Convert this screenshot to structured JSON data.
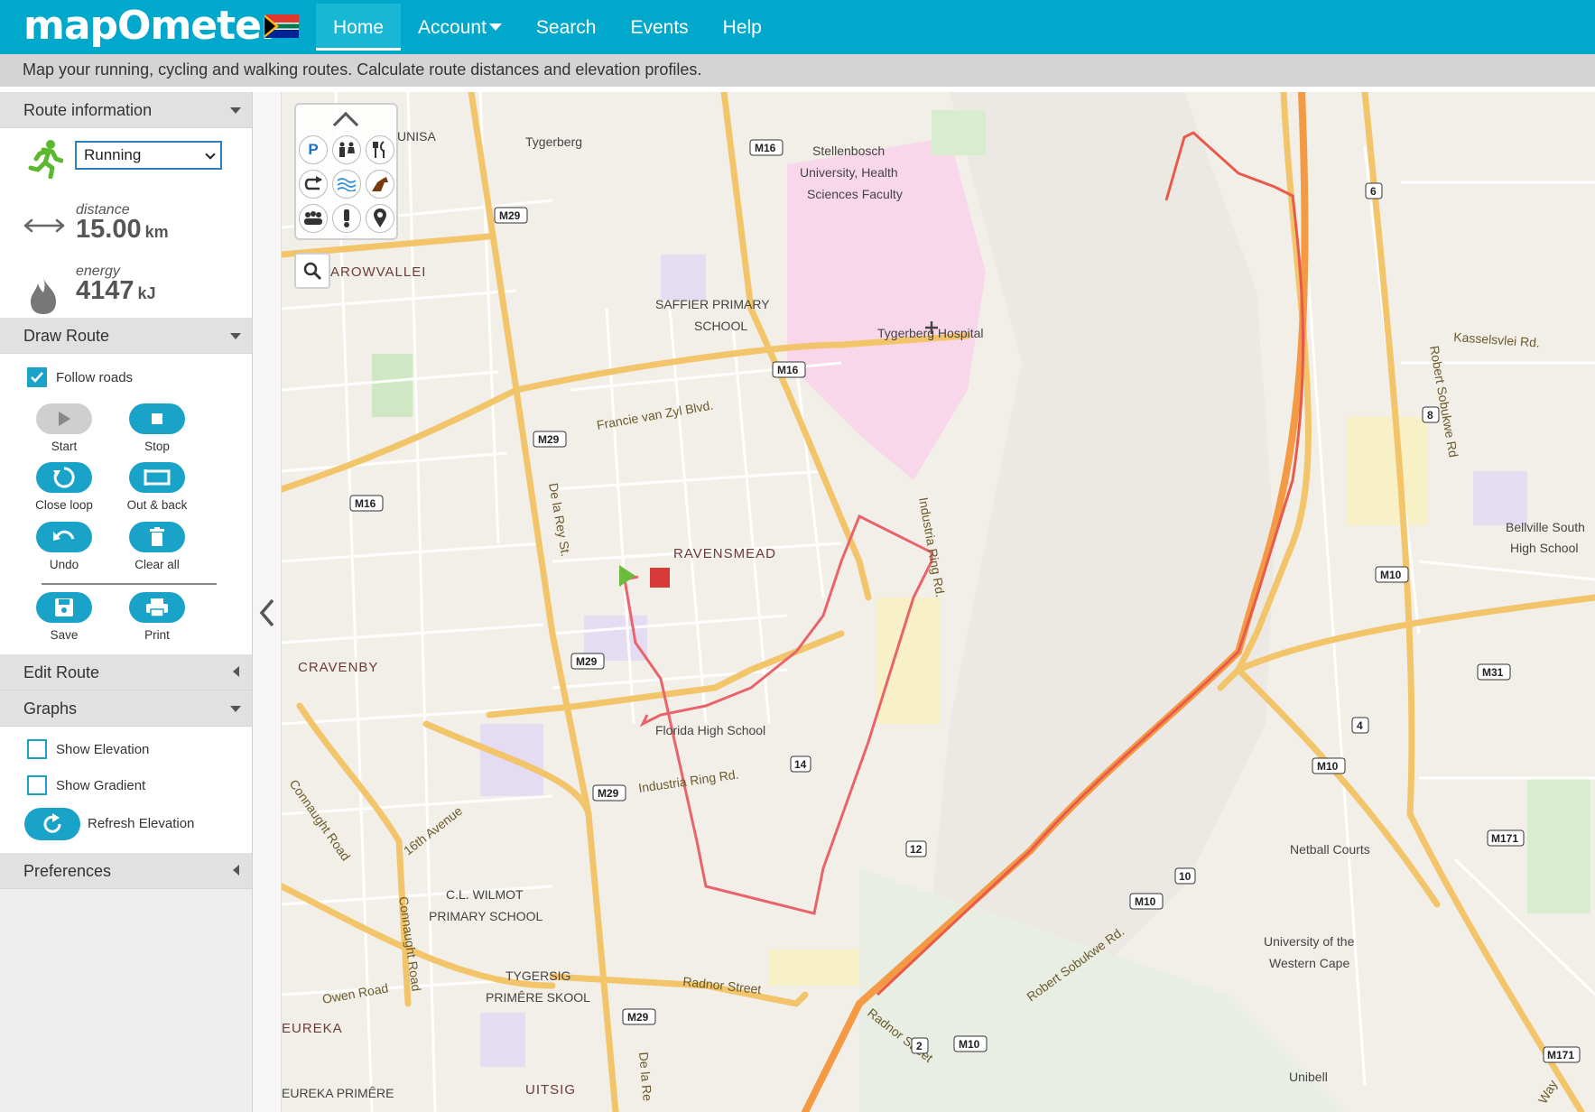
{
  "app": {
    "logo": "mapOmeter",
    "tagline": "Map your running, cycling and walking routes. Calculate route distances and elevation profiles."
  },
  "nav": {
    "items": [
      "Home",
      "Account",
      "Search",
      "Events",
      "Help"
    ],
    "active": "Home"
  },
  "route_info": {
    "header": "Route information",
    "activity": "Running",
    "distance_label": "distance",
    "distance_value": "15.00",
    "distance_unit": "km",
    "energy_label": "energy",
    "energy_value": "4147",
    "energy_unit": "kJ"
  },
  "draw_route": {
    "header": "Draw Route",
    "follow_roads": "Follow roads",
    "follow_roads_checked": true,
    "buttons": {
      "start": "Start",
      "stop": "Stop",
      "close_loop": "Close loop",
      "out_back": "Out & back",
      "undo": "Undo",
      "clear_all": "Clear all",
      "save": "Save",
      "print": "Print"
    }
  },
  "edit_route": {
    "header": "Edit Route"
  },
  "graphs": {
    "header": "Graphs",
    "show_elevation": "Show Elevation",
    "show_gradient": "Show Gradient",
    "refresh_elevation": "Refresh Elevation"
  },
  "preferences": {
    "header": "Preferences"
  },
  "colors": {
    "brand": "#00a9cc",
    "button": "#1aa3c8",
    "route": "#e8646a",
    "start_marker": "#6cbb3c",
    "end_marker": "#d83a3a"
  },
  "map": {
    "labels": {
      "unisa": "UNISA",
      "tygerberg": "Tygerberg",
      "stellenbosch1": "Stellenbosch",
      "stellenbosch2": "University, Health",
      "stellenbosch3": "Sciences Faculty",
      "tygerberg_hospital": "Tygerberg Hospital",
      "saffier1": "SAFFIER PRIMARY",
      "saffier2": "SCHOOL",
      "arowvallei": "AROWVALLEI",
      "ravensmead": "RAVENSMEAD",
      "cravenby": "CRAVENBY",
      "florida": "Florida High School",
      "wilmot1": "C.L. WILMOT",
      "wilmot2": "PRIMARY SCHOOL",
      "tygersig1": "TYGERSIG",
      "tygersig2": "PRIMÊRE SKOOL",
      "eureka": "EUREKA",
      "eureka_primere": "EUREKA PRIMÊRE",
      "uitsig": "UITSIG",
      "bellville1": "Bellville South",
      "bellville2": "High School",
      "netball": "Netball Courts",
      "uwc1": "University of the",
      "uwc2": "Western Cape",
      "unibell": "Unibell"
    },
    "roads": {
      "francie": "Francie van Zyl Blvd.",
      "delarey": "De la Rey St.",
      "delarey2": "De la Re",
      "industria": "Industria Ring Rd.",
      "industria2": "Industria Ring Rd.",
      "connaught": "Connaught Road",
      "connaught2": "Connaught Road",
      "sixteenth": "16th Avenue",
      "owen": "Owen Road",
      "radnor": "Radnor Street",
      "radnor2": "Radnor Street",
      "kasselsvlei": "Kasselsvlei Rd.",
      "robert1": "Robert Sobukwe Rd",
      "robert2": "Robert Sobukwe Rd.",
      "way": "Way"
    },
    "shields": [
      "M16",
      "M29",
      "M29",
      "M16",
      "M29",
      "M16",
      "M29",
      "14",
      "12",
      "2",
      "M10",
      "M10",
      "10",
      "M10",
      "4",
      "M10",
      "8",
      "6",
      "M31",
      "M171",
      "M171",
      "M29"
    ]
  }
}
